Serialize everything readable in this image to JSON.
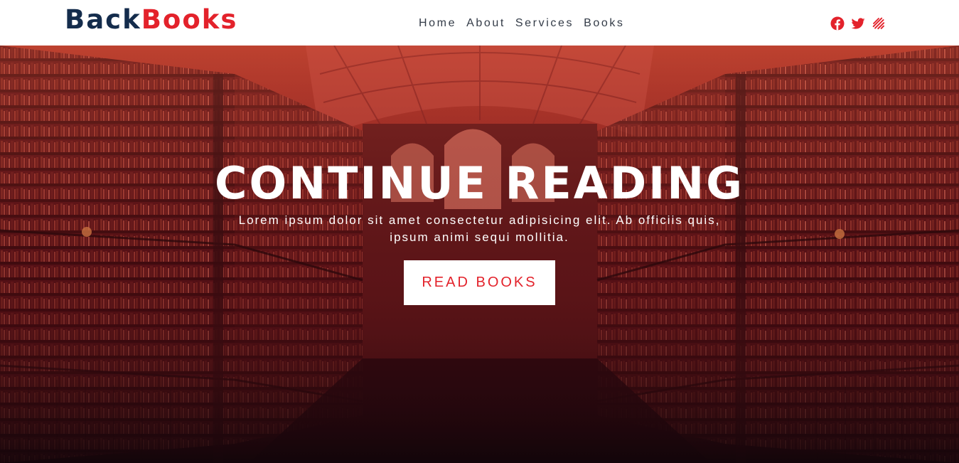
{
  "brand": {
    "part1": "Back",
    "part2": "Books"
  },
  "nav": {
    "items": [
      "Home",
      "About",
      "Services",
      "Books"
    ]
  },
  "social": {
    "icons": [
      "facebook-icon",
      "twitter-icon",
      "brand-stripes-icon"
    ],
    "color": "#e3222b"
  },
  "hero": {
    "title": "CONTINUE READING",
    "text": "Lorem ipsum dolor sit amet consectetur adipisicing elit. Ab officiis quis, ipsum animi sequi mollitia.",
    "button_label": "READ BOOKS",
    "overlay_color": "#8e2020"
  },
  "colors": {
    "navy": "#142c4c",
    "red": "#e3222b"
  }
}
